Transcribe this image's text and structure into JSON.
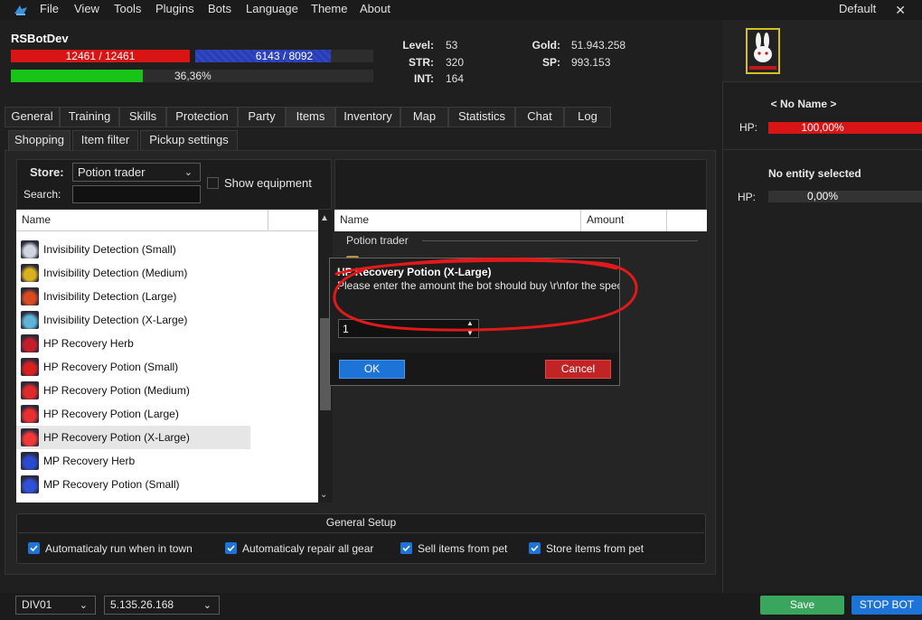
{
  "menubar": {
    "items": [
      "File",
      "View",
      "Tools",
      "Plugins",
      "Bots",
      "Language",
      "Theme",
      "About"
    ],
    "theme": "Default",
    "close": "✕"
  },
  "character": {
    "name": "RSBotDev",
    "hp_text": "12461 / 12461",
    "hp_fraction": 1.0,
    "mp_text": "6143 / 8092",
    "mp_fraction": 0.759,
    "exp_text": "36,36%",
    "exp_fraction": 0.3636,
    "level_label": "Level:",
    "level": "53",
    "str_label": "STR:",
    "str": "320",
    "int_label": "INT:",
    "int": "164",
    "gold_label": "Gold:",
    "gold": "51.943.258",
    "sp_label": "SP:",
    "sp": "993.153"
  },
  "tabs": [
    "General",
    "Training",
    "Skills",
    "Protection",
    "Party",
    "Items",
    "Inventory",
    "Map",
    "Statistics",
    "Chat",
    "Log"
  ],
  "subtabs": [
    "Shopping",
    "Item filter",
    "Pickup settings"
  ],
  "store": {
    "label": "Store:",
    "selected": "Potion trader",
    "search_label": "Search:",
    "search_value": "",
    "show_equipment": "Show equipment"
  },
  "shop_list": {
    "column": "Name",
    "items": [
      {
        "label": "Invisibility Detection (Small)",
        "icon": "potion-white-icon",
        "color": "#cfd6de"
      },
      {
        "label": "Invisibility Detection (Medium)",
        "icon": "potion-yellow-icon",
        "color": "#d8b020"
      },
      {
        "label": "Invisibility Detection (Large)",
        "icon": "potion-orange-icon",
        "color": "#d84a20"
      },
      {
        "label": "Invisibility Detection (X-Large)",
        "icon": "potion-cyan-icon",
        "color": "#5fb4d8"
      },
      {
        "label": "HP Recovery Herb",
        "icon": "herb-red-icon",
        "color": "#c41e2a"
      },
      {
        "label": "HP Recovery Potion (Small)",
        "icon": "potion-red-icon",
        "color": "#d82020"
      },
      {
        "label": "HP Recovery Potion (Medium)",
        "icon": "potion-red-icon",
        "color": "#e02a2a"
      },
      {
        "label": "HP Recovery Potion (Large)",
        "icon": "potion-red-icon",
        "color": "#e83030"
      },
      {
        "label": "HP Recovery Potion (X-Large)",
        "icon": "potion-red-icon",
        "color": "#f03838"
      },
      {
        "label": "MP Recovery Herb",
        "icon": "herb-blue-icon",
        "color": "#2a4ad0"
      },
      {
        "label": "MP Recovery Potion (Small)",
        "icon": "potion-blue-icon",
        "color": "#3050d8"
      }
    ],
    "selected_index": 8
  },
  "cart": {
    "col_name": "Name",
    "col_amount": "Amount",
    "group": "Potion trader"
  },
  "dialog": {
    "title": "HP Recovery Potion (X-Large)",
    "message": "Please enter the amount the bot should buy \\r\\nfor the specified item",
    "value": "1",
    "ok": "OK",
    "cancel": "Cancel"
  },
  "general_setup": {
    "title": "General Setup",
    "options": [
      {
        "label": "Automaticaly run when in town",
        "checked": true
      },
      {
        "label": "Automaticaly repair all gear",
        "checked": true
      },
      {
        "label": "Sell items from pet",
        "checked": true
      },
      {
        "label": "Store items from pet",
        "checked": true
      }
    ]
  },
  "bottom": {
    "division": "DIV01",
    "server_ip": "5.135.26.168",
    "save": "Save",
    "stop": "STOP BOT"
  },
  "right_panel": {
    "pet_name": "< No Name >",
    "pet_hp_label": "HP:",
    "pet_hp_text": "100,00%",
    "pet_hp_fraction": 1.0,
    "entity_title": "No entity selected",
    "entity_hp_label": "HP:",
    "entity_hp_text": "0,00%",
    "entity_hp_fraction": 0.0
  },
  "colors": {
    "accent_blue": "#1e74d6",
    "hp_red": "#d91414",
    "exp_green": "#19c419",
    "save_green": "#3aa55c",
    "cancel_red": "#c02424",
    "annotation_red": "#e01a1a"
  }
}
